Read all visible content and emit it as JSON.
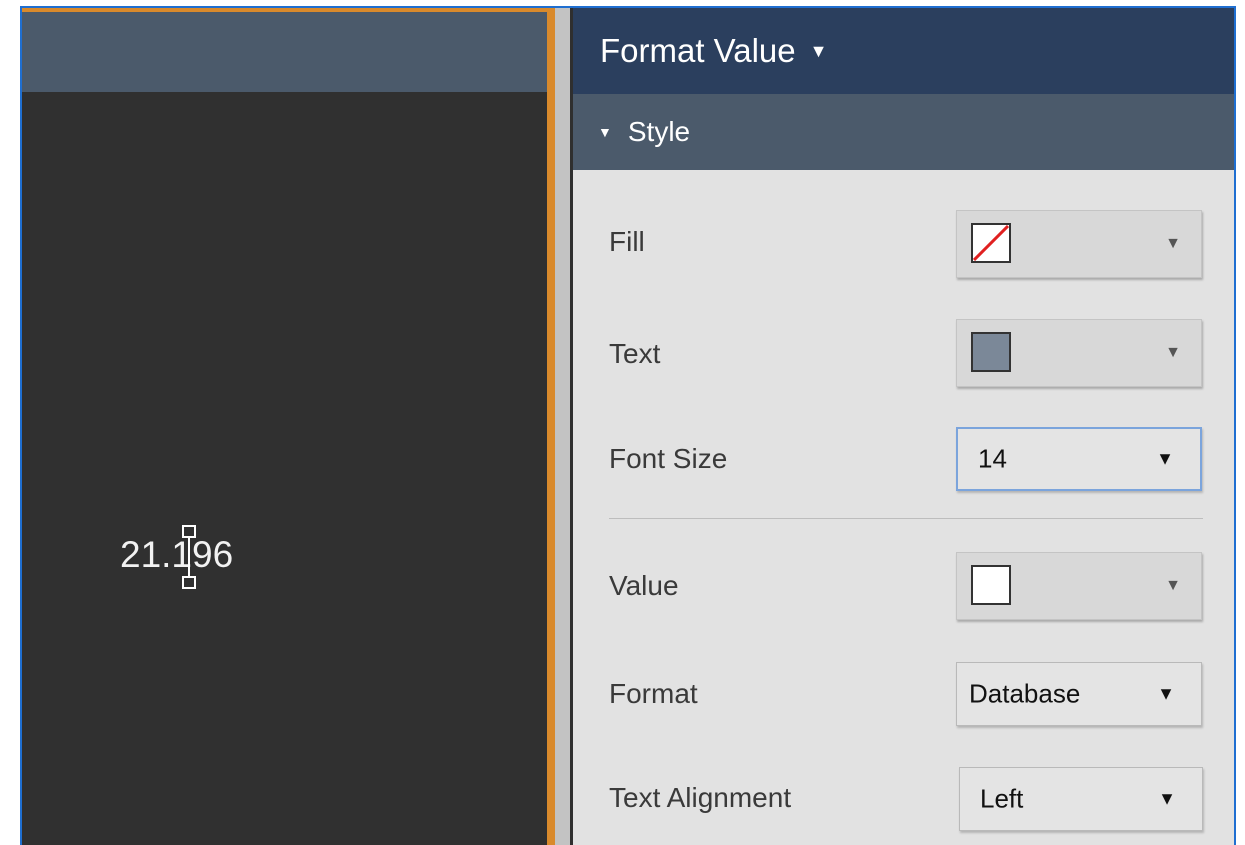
{
  "canvas": {
    "value_text": "21.196"
  },
  "panel": {
    "title": "Format Value",
    "title_caret": "▼",
    "section": {
      "label": "Style",
      "caret": "▼"
    },
    "rows": {
      "fill": {
        "label": "Fill",
        "swatch": "none",
        "arrow": "▼"
      },
      "text": {
        "label": "Text",
        "swatch_color": "#7b8898",
        "arrow": "▼"
      },
      "font_size": {
        "label": "Font Size",
        "value": "14",
        "arrow": "▼"
      },
      "value": {
        "label": "Value",
        "swatch_color": "#ffffff",
        "arrow": "▼"
      },
      "format": {
        "label": "Format",
        "value": "Database",
        "arrow": "▼"
      },
      "text_alignment": {
        "label": "Text Alignment",
        "value": "Left",
        "arrow": "▼"
      }
    }
  },
  "colors": {
    "panel_title_bg": "#2b3f5e",
    "section_bg": "#4b5a6b",
    "accent_orange": "#d98a2c",
    "frame_border": "#1f6fd1",
    "no_fill_slash": "#e02020"
  }
}
